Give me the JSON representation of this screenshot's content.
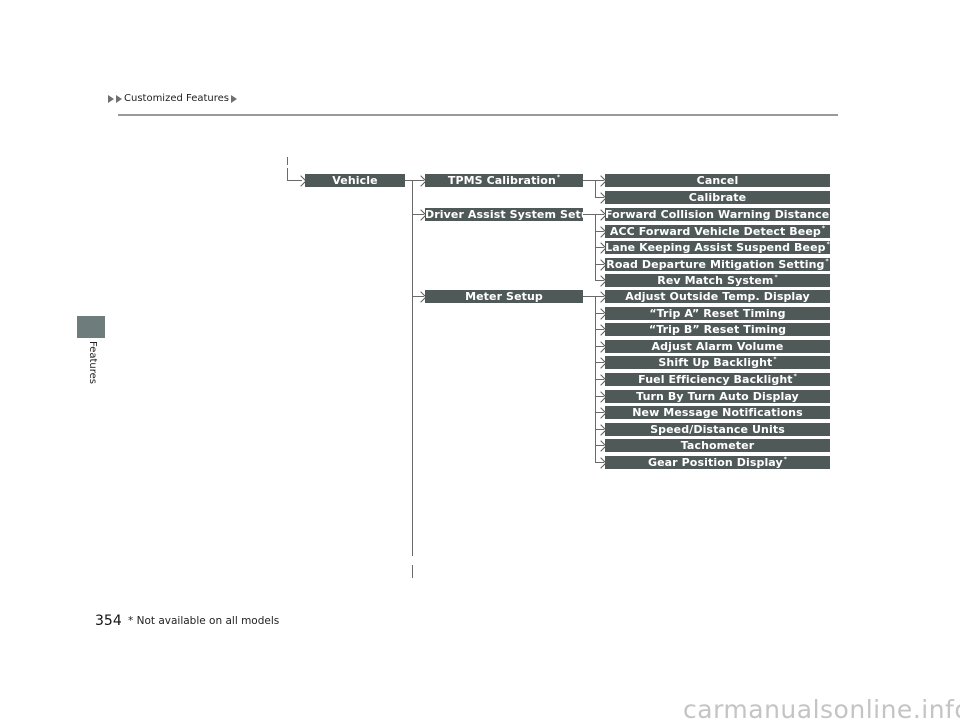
{
  "header": {
    "breadcrumb": "Customized Features",
    "breadcrumb_prefix_icon": "double-triangle-right-icon",
    "breadcrumb_suffix_icon": "triangle-right-icon"
  },
  "side_tab": {
    "label": "Features",
    "color": "#6e7d7c"
  },
  "tree": {
    "root": {
      "label": "Vehicle"
    },
    "level2": [
      {
        "label": "TPMS Calibration",
        "footnote": "*"
      },
      {
        "label": "Driver Assist System Setup",
        "footnote": ""
      },
      {
        "label": "Meter Setup",
        "footnote": ""
      }
    ],
    "tpms_children": [
      {
        "label": "Cancel",
        "footnote": ""
      },
      {
        "label": "Calibrate",
        "footnote": ""
      }
    ],
    "driver_assist_children": [
      {
        "label": "Forward Collision Warning Distance",
        "footnote": "*"
      },
      {
        "label": "ACC Forward Vehicle Detect Beep",
        "footnote": "*"
      },
      {
        "label": "Lane Keeping Assist Suspend Beep",
        "footnote": "*"
      },
      {
        "label": "Road Departure Mitigation Setting",
        "footnote": "*"
      },
      {
        "label": "Rev Match System",
        "footnote": "*"
      }
    ],
    "meter_children": [
      {
        "label": "Adjust Outside Temp. Display",
        "footnote": ""
      },
      {
        "label": "“Trip A” Reset Timing",
        "footnote": ""
      },
      {
        "label": "“Trip B” Reset Timing",
        "footnote": ""
      },
      {
        "label": "Adjust Alarm Volume",
        "footnote": ""
      },
      {
        "label": "Shift Up Backlight",
        "footnote": "*"
      },
      {
        "label": "Fuel Efficiency Backlight",
        "footnote": "*"
      },
      {
        "label": "Turn By Turn Auto Display",
        "footnote": ""
      },
      {
        "label": "New Message Notifications",
        "footnote": ""
      },
      {
        "label": "Speed/Distance Units",
        "footnote": ""
      },
      {
        "label": "Tachometer",
        "footnote": ""
      },
      {
        "label": "Gear Position Display",
        "footnote": "*"
      }
    ],
    "box_color": "#4f5958",
    "connector_color": "#6a6a6a"
  },
  "footer": {
    "page_number": "354",
    "footnote": "* Not available on all models"
  },
  "watermark": "carmanualsonline.info"
}
